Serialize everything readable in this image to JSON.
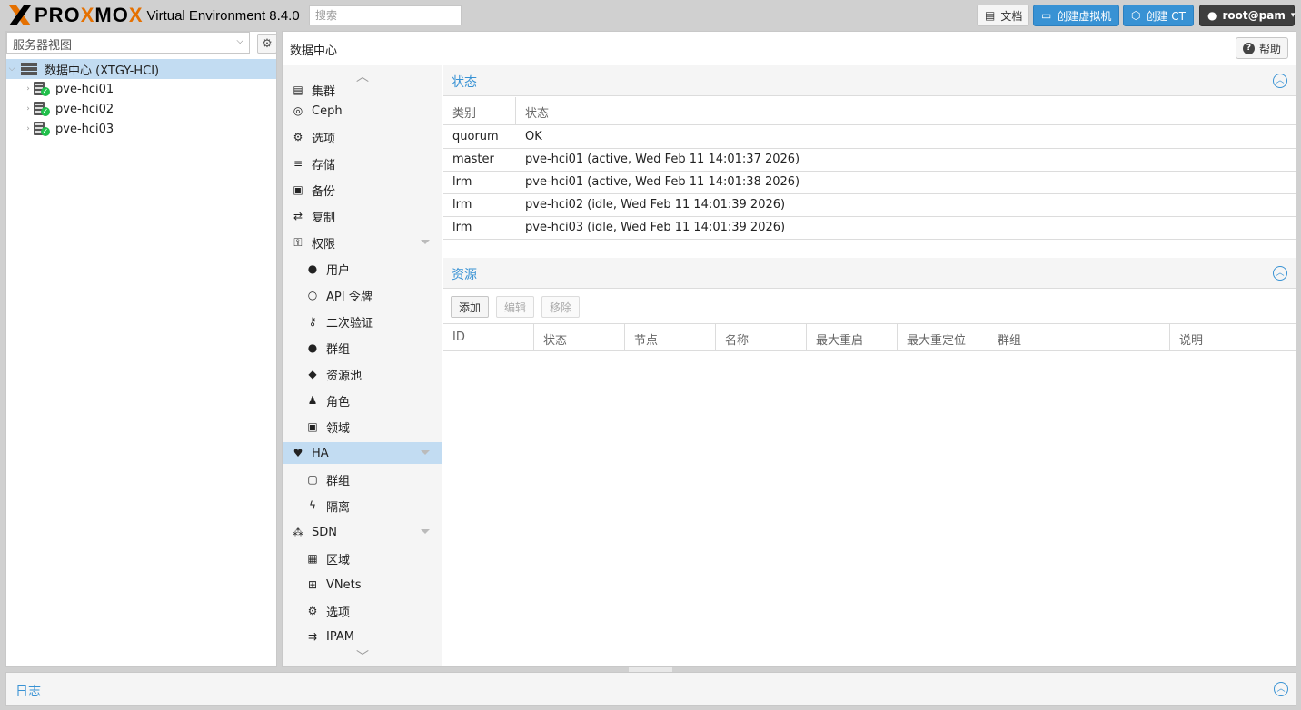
{
  "header": {
    "brand_pre": "PRO",
    "brand_x": "X",
    "brand_mo": "MO",
    "brand_x2": "X",
    "version": "Virtual Environment 8.4.0",
    "search_placeholder": "搜索",
    "docs": "文档",
    "create_vm": "创建虚拟机",
    "create_ct": "创建 CT",
    "user": "root@pam"
  },
  "tree": {
    "view": "服务器视图",
    "datacenter": "数据中心 (XTGY-HCI)",
    "nodes": [
      "pve-hci01",
      "pve-hci02",
      "pve-hci03"
    ]
  },
  "main": {
    "title": "数据中心",
    "help": "帮助"
  },
  "nav": [
    {
      "label": "集群",
      "icon": "cluster-icon",
      "glyph": "▤"
    },
    {
      "label": "Ceph",
      "icon": "ceph-icon",
      "glyph": "◎"
    },
    {
      "label": "选项",
      "icon": "gear-icon",
      "glyph": "⚙"
    },
    {
      "label": "存储",
      "icon": "database-icon",
      "glyph": "≡"
    },
    {
      "label": "备份",
      "icon": "floppy-icon",
      "glyph": "▣"
    },
    {
      "label": "复制",
      "icon": "retweet-icon",
      "glyph": "⇄"
    },
    {
      "label": "权限",
      "icon": "unlock-icon",
      "glyph": "⚿"
    },
    {
      "label": "用户",
      "icon": "user-icon",
      "glyph": "●"
    },
    {
      "label": "API 令牌",
      "icon": "user-outline-icon",
      "glyph": "○"
    },
    {
      "label": "二次验证",
      "icon": "key-icon",
      "glyph": "⚷"
    },
    {
      "label": "群组",
      "icon": "users-icon",
      "glyph": "●"
    },
    {
      "label": "资源池",
      "icon": "tags-icon",
      "glyph": "◆"
    },
    {
      "label": "角色",
      "icon": "male-icon",
      "glyph": "♟"
    },
    {
      "label": "领域",
      "icon": "address-book-icon",
      "glyph": "▣"
    },
    {
      "label": "HA",
      "icon": "heartbeat-icon",
      "glyph": "♥"
    },
    {
      "label": "群组",
      "icon": "object-group-icon",
      "glyph": "▢"
    },
    {
      "label": "隔离",
      "icon": "bolt-icon",
      "glyph": "ϟ"
    },
    {
      "label": "SDN",
      "icon": "sdn-icon",
      "glyph": "⁂"
    },
    {
      "label": "区域",
      "icon": "th-icon",
      "glyph": "▦"
    },
    {
      "label": "VNets",
      "icon": "sitemap-icon",
      "glyph": "⊞"
    },
    {
      "label": "选项",
      "icon": "gear-icon",
      "glyph": "⚙"
    },
    {
      "label": "IPAM",
      "icon": "ipam-icon",
      "glyph": "⇉"
    }
  ],
  "status": {
    "title": "状态",
    "col_type": "类别",
    "col_status": "状态",
    "rows": [
      {
        "type": "quorum",
        "status": "OK"
      },
      {
        "type": "master",
        "status": "pve-hci01 (active, Wed Feb 11 14:01:37 2026)"
      },
      {
        "type": "lrm",
        "status": "pve-hci01 (active, Wed Feb 11 14:01:38 2026)"
      },
      {
        "type": "lrm",
        "status": "pve-hci02 (idle, Wed Feb 11 14:01:39 2026)"
      },
      {
        "type": "lrm",
        "status": "pve-hci03 (idle, Wed Feb 11 14:01:39 2026)"
      }
    ]
  },
  "resources": {
    "title": "资源",
    "add": "添加",
    "edit": "编辑",
    "remove": "移除",
    "columns": [
      "ID",
      "状态",
      "节点",
      "名称",
      "最大重启",
      "最大重定位",
      "群组",
      "说明"
    ]
  },
  "log": {
    "title": "日志"
  }
}
